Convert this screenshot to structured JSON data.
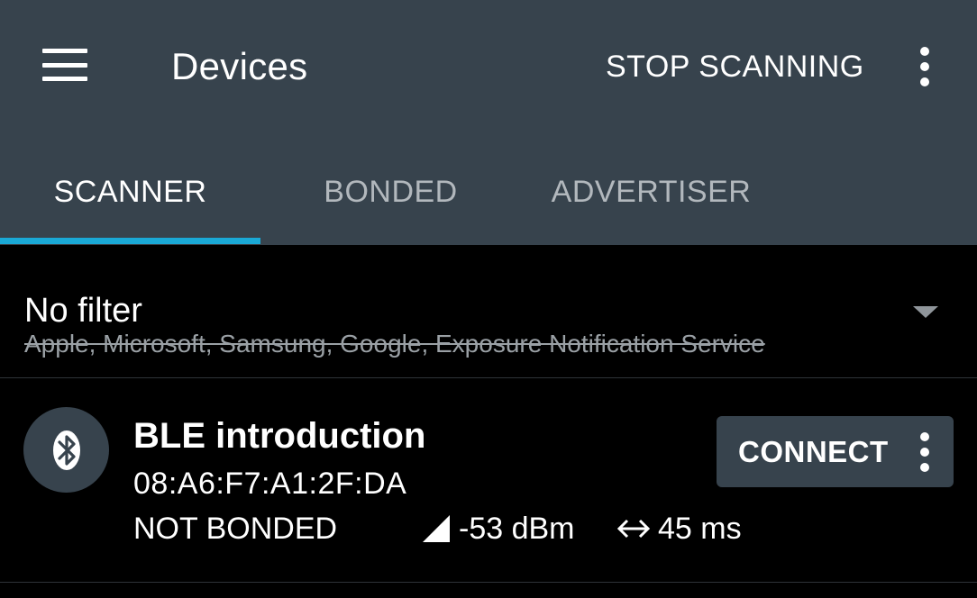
{
  "appbar": {
    "title": "Devices",
    "action_label": "STOP SCANNING",
    "menu_icon": "hamburger-menu-icon",
    "overflow_icon": "more-vert-icon",
    "background_color": "#37434d"
  },
  "tabs": [
    {
      "label": "SCANNER",
      "active": true
    },
    {
      "label": "BONDED",
      "active": false
    },
    {
      "label": "ADVERTISER",
      "active": false
    }
  ],
  "tab_indicator_color": "#1aa9d6",
  "filter": {
    "title": "No filter",
    "excluded": "Apple, Microsoft, Samsung, Google, Exposure Notification Service",
    "dropdown_icon": "arrow-drop-down-icon"
  },
  "devices": [
    {
      "icon": "bluetooth-icon",
      "name": "BLE introduction",
      "address": "08:A6:F7:A1:2F:DA",
      "bond_state": "NOT BONDED",
      "rssi": "-53 dBm",
      "interval": "45 ms",
      "connect_label": "CONNECT"
    }
  ]
}
